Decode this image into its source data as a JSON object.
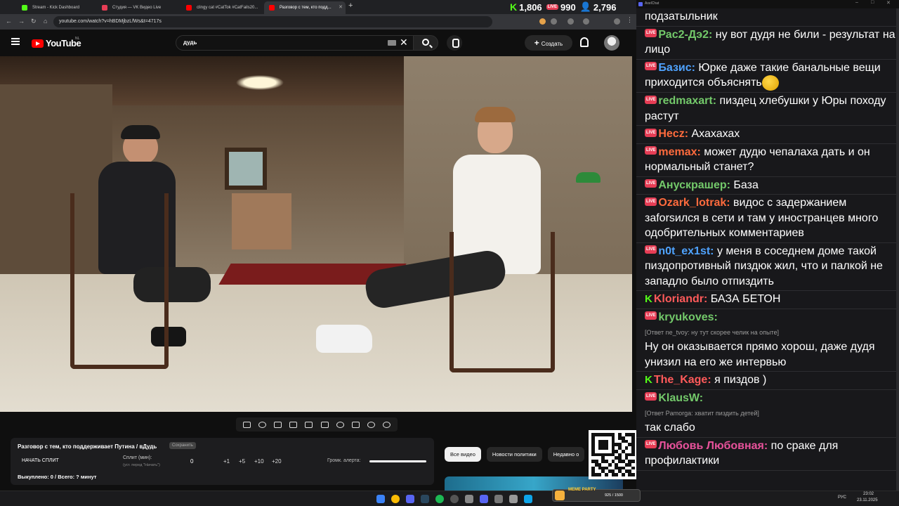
{
  "browser": {
    "tabs": [
      {
        "title": "Stream - Kick Dashboard",
        "icon_color": "#53fc18",
        "active": false
      },
      {
        "title": "Студия — VK Видео Live",
        "icon_color": "#e63d55",
        "active": false
      },
      {
        "title": "clingy cat #CatTok #CatFails20...",
        "icon_color": "#ff0000",
        "active": false
      },
      {
        "title": "Разговор с тем, кто подд...",
        "icon_color": "#ff0000",
        "active": true
      }
    ],
    "new_tab": "+",
    "url": "youtube.com/watch?v=hBDMjbzLfWs&t=4717s"
  },
  "stream_stats": {
    "kick_viewers": "1,806",
    "vk_viewers": "990",
    "total_viewers": "2,796",
    "live_label": "LIVE",
    "kick_letter": "K",
    "viewers_icon": "person-icon"
  },
  "youtube": {
    "logo_text": "YouTube",
    "region": "NL",
    "search_query": "дудь",
    "create_label": "Создать",
    "create_plus": "+"
  },
  "split_panel": {
    "title": "Разговор с тем, кто поддерживает Путина / вДудь",
    "badge": "Сохранить",
    "start_split": "НАЧАТЬ СПЛИТ",
    "split_min_label": "Сплит (мин):",
    "split_note": "(уст. перед \"Начать\")",
    "split_value": "0",
    "increments": [
      "+1",
      "+5",
      "+10",
      "+20"
    ],
    "volume_label": "Громк. алерта:",
    "volume_level": 1.0,
    "bought": "Выкуплено: 0 / Всего: ? минут"
  },
  "chips": [
    "Все видео",
    "Новости политики",
    "Недавно о"
  ],
  "chat": {
    "window_title": "AxelChat",
    "messages": [
      {
        "platform": "",
        "nick": "",
        "color": "#ffffff",
        "text": "подзатыльник",
        "reply": ""
      },
      {
        "platform": "vk",
        "nick": "Рас2-Дэ2:",
        "color": "#73c96a",
        "text": " ну вот дудя не били - результат на лицо",
        "reply": ""
      },
      {
        "platform": "vk",
        "nick": "Базис:",
        "color": "#4fa3ff",
        "text": " Юрке даже такие банальные вещи приходится объяснять",
        "reply": "",
        "emoji": "monocle-face-icon"
      },
      {
        "platform": "vk",
        "nick": "redmaxart:",
        "color": "#73c96a",
        "text": " пиздец хлебушки у Юры походу растут",
        "reply": ""
      },
      {
        "platform": "vk",
        "nick": "Hecz:",
        "color": "#ff6b3d",
        "text": " Ахахахах",
        "reply": ""
      },
      {
        "platform": "vk",
        "nick": "memax:",
        "color": "#ff6b3d",
        "text": " может дудю чепалаха дать и он нормальный станет?",
        "reply": ""
      },
      {
        "platform": "vk",
        "nick": "Анускрашер:",
        "color": "#73c96a",
        "text": " База",
        "reply": ""
      },
      {
        "platform": "vk",
        "nick": "Ozark_lotrak:",
        "color": "#ff6b3d",
        "text": " видос с задержанием заforsился в сети и там у иностранцев много одобрительных комментариев",
        "reply": ""
      },
      {
        "platform": "vk",
        "nick": "n0t_ex1st:",
        "color": "#4fa3ff",
        "text": " у меня в соседнем доме такой пиздопротивный пиздюк жил, что и палкой не западло было отпиздить",
        "reply": ""
      },
      {
        "platform": "kick",
        "nick": "Kloriandr:",
        "color": "#ff5a5a",
        "text": " БАЗА БЕТОН",
        "reply": ""
      },
      {
        "platform": "vk",
        "nick": "kryukoves:",
        "color": "#73c96a",
        "text": "",
        "reply": "[Ответ ne_tvoy: ну тут скорее челик на опыте]",
        "after": "Ну он оказывается прямо хорош, даже дудя унизил на его же интервью"
      },
      {
        "platform": "kick",
        "nick": "The_Kage:",
        "color": "#ff5a5a",
        "text": " я пиздов )",
        "reply": ""
      },
      {
        "platform": "vk",
        "nick": "KlausW:",
        "color": "#73c96a",
        "text": "",
        "reply": "[Ответ Pamorga: хватит пиздить детей]",
        "after": "так слабо"
      },
      {
        "platform": "vk",
        "nick": "Любовь Любовная:",
        "color": "#e8529b",
        "text": " по сраке для профилактики",
        "reply": ""
      }
    ]
  },
  "meme_widget": {
    "title": "MEME PARTY",
    "count": "925 / 1500"
  },
  "system": {
    "lang": "РУС",
    "time": "23:02",
    "date": "23.11.2025"
  }
}
